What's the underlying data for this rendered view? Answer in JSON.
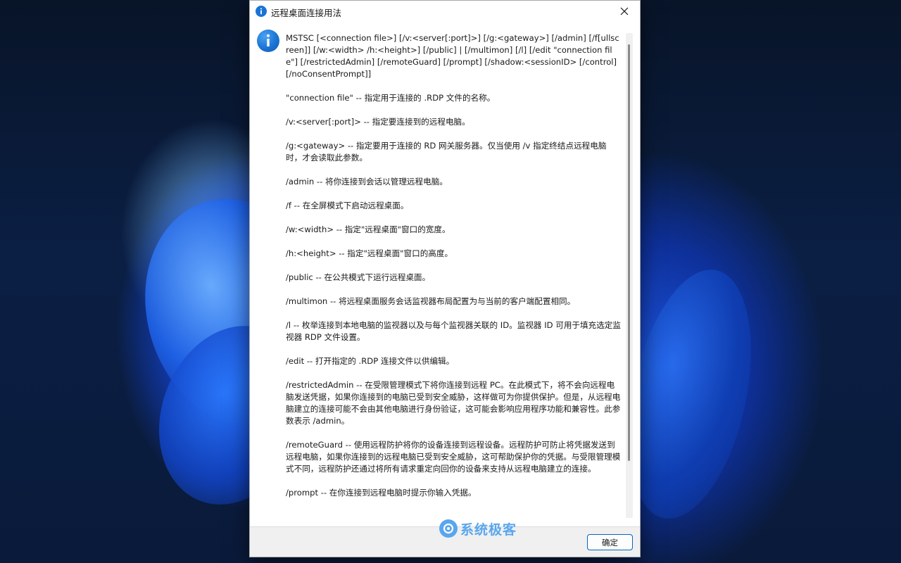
{
  "dialog": {
    "title": "远程桌面连接用法",
    "ok_label": "确定",
    "message": "MSTSC [<connection file>] [/v:<server[:port]>] [/g:<gateway>] [/admin] [/f[ullscreen]] [/w:<width> /h:<height>] [/public] | [/multimon] [/l] [/edit \"connection file\"] [/restrictedAdmin] [/remoteGuard] [/prompt] [/shadow:<sessionID> [/control] [/noConsentPrompt]]\n\n\"connection file\" -- 指定用于连接的 .RDP 文件的名称。\n\n/v:<server[:port]> -- 指定要连接到的远程电脑。\n\n/g:<gateway> -- 指定要用于连接的 RD 网关服务器。仅当使用 /v 指定终结点远程电脑时，才会读取此参数。\n\n/admin -- 将你连接到会话以管理远程电脑。\n\n/f -- 在全屏模式下启动远程桌面。\n\n/w:<width> -- 指定\"远程桌面\"窗口的宽度。\n\n/h:<height> -- 指定\"远程桌面\"窗口的高度。\n\n/public -- 在公共模式下运行远程桌面。\n\n/multimon -- 将远程桌面服务会话监视器布局配置为与当前的客户端配置相同。\n\n/l -- 枚举连接到本地电脑的监视器以及与每个监视器关联的 ID。监视器 ID 可用于填充选定监视器 RDP 文件设置。\n\n/edit -- 打开指定的 .RDP 连接文件以供编辑。\n\n/restrictedAdmin -- 在受限管理模式下将你连接到远程 PC。在此模式下，将不会向远程电脑发送凭据，如果你连接到的电脑已受到安全威胁，这样做可为你提供保护。但是，从远程电脑建立的连接可能不会由其他电脑进行身份验证，这可能会影响应用程序功能和兼容性。此参数表示 /admin。\n\n/remoteGuard -- 使用远程防护将你的设备连接到远程设备。远程防护可防止将凭据发送到远程电脑，如果你连接到的远程电脑已受到安全威胁，这可帮助保护你的凭据。与受限管理模式不同，远程防护还通过将所有请求重定向回你的设备来支持从远程电脑建立的连接。\n\n/prompt -- 在你连接到远程电脑时提示你输入凭据。"
  },
  "watermark": {
    "text": "系统极客"
  },
  "colors": {
    "accent": "#0067c0",
    "info_icon": "#1b73d4",
    "watermark": "#5aa6ee"
  },
  "icons": {
    "title": "info-icon",
    "message": "info-icon",
    "close": "close-icon"
  }
}
